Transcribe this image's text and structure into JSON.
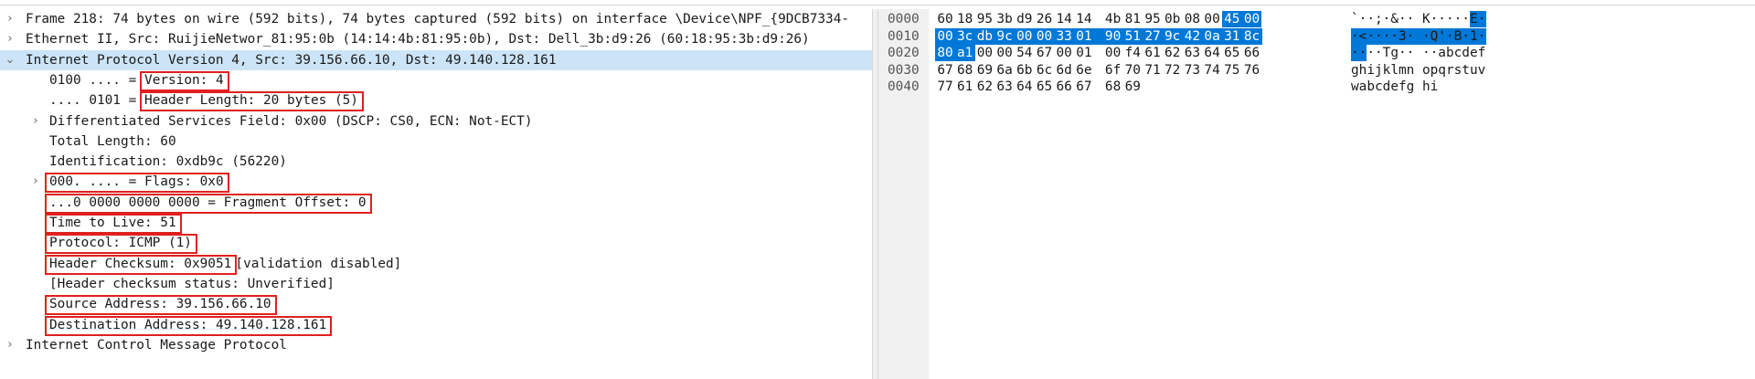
{
  "details": {
    "rows": [
      {
        "text": "Frame 218: 74 bytes on wire (592 bits), 74 bytes captured (592 bits) on interface \\Device\\NPF_{9DCB7334-",
        "chevron": "collapsed"
      },
      {
        "text": "Ethernet II, Src: RuijieNetwor_81:95:0b (14:14:4b:81:95:0b), Dst: Dell_3b:d9:26 (60:18:95:3b:d9:26)",
        "chevron": "collapsed"
      },
      {
        "text": "Internet Protocol Version 4, Src: 39.156.66.10, Dst: 49.140.128.161",
        "chevron": "expanded",
        "selected": true
      },
      {
        "text": "0100 .... = ",
        "boxed": "Version: 4"
      },
      {
        "text": ".... 0101 = ",
        "boxed": "Header Length: 20 bytes (5)"
      },
      {
        "text": "Differentiated Services Field: 0x00 (DSCP: CS0, ECN: Not-ECT)",
        "chevron": "collapsed"
      },
      {
        "text": "Total Length: 60"
      },
      {
        "text": "Identification: 0xdb9c (56220)"
      },
      {
        "text": "",
        "boxed": "000. .... = Flags: 0x0",
        "chevron": "collapsed"
      },
      {
        "text": "",
        "boxed": "...0 0000 0000 0000 = Fragment Offset: 0"
      },
      {
        "text": "",
        "boxed": "Time to Live: 51"
      },
      {
        "text": "",
        "boxed": "Protocol: ICMP (1)"
      },
      {
        "text": "",
        "boxed": "Header Checksum: 0x9051",
        "suffix": " [validation disabled]"
      },
      {
        "text": "[Header checksum status: Unverified]"
      },
      {
        "text": "",
        "boxed": "Source Address: 39.156.66.10"
      },
      {
        "text": "",
        "boxed": "Destination Address: 49.140.128.161"
      },
      {
        "text": "Internet Control Message Protocol",
        "chevron": "collapsed"
      }
    ]
  },
  "bytes": {
    "rows": [
      {
        "offset": "0000",
        "hex": [
          "60",
          "18",
          "95",
          "3b",
          "d9",
          "26",
          "14",
          "14",
          "4b",
          "81",
          "95",
          "0b",
          "08",
          "00",
          "45",
          "00"
        ],
        "ascii": "`··;·&·· K·····E·",
        "hl_start": 14,
        "hl_end": 16
      },
      {
        "offset": "0010",
        "hex": [
          "00",
          "3c",
          "db",
          "9c",
          "00",
          "00",
          "33",
          "01",
          "90",
          "51",
          "27",
          "9c",
          "42",
          "0a",
          "31",
          "8c"
        ],
        "ascii": "·<····3· ·Q'·B·1·",
        "hl_start": 0,
        "hl_end": 16
      },
      {
        "offset": "0020",
        "hex": [
          "80",
          "a1",
          "00",
          "00",
          "54",
          "67",
          "00",
          "01",
          "00",
          "f4",
          "61",
          "62",
          "63",
          "64",
          "65",
          "66"
        ],
        "ascii": "····Tg·· ··abcdef",
        "hl_start": 0,
        "hl_end": 2
      },
      {
        "offset": "0030",
        "hex": [
          "67",
          "68",
          "69",
          "6a",
          "6b",
          "6c",
          "6d",
          "6e",
          "6f",
          "70",
          "71",
          "72",
          "73",
          "74",
          "75",
          "76"
        ],
        "ascii": "ghijklmn opqrstuv",
        "hl_start": 0,
        "hl_end": 0
      },
      {
        "offset": "0040",
        "hex": [
          "77",
          "61",
          "62",
          "63",
          "64",
          "65",
          "66",
          "67",
          "68",
          "69"
        ],
        "ascii": "wabcdefg hi",
        "hl_start": 0,
        "hl_end": 0
      }
    ]
  },
  "colors": {
    "selection": "#cce4f7",
    "byte_highlight": "#0078d7",
    "annotation_box": "#e02020"
  }
}
